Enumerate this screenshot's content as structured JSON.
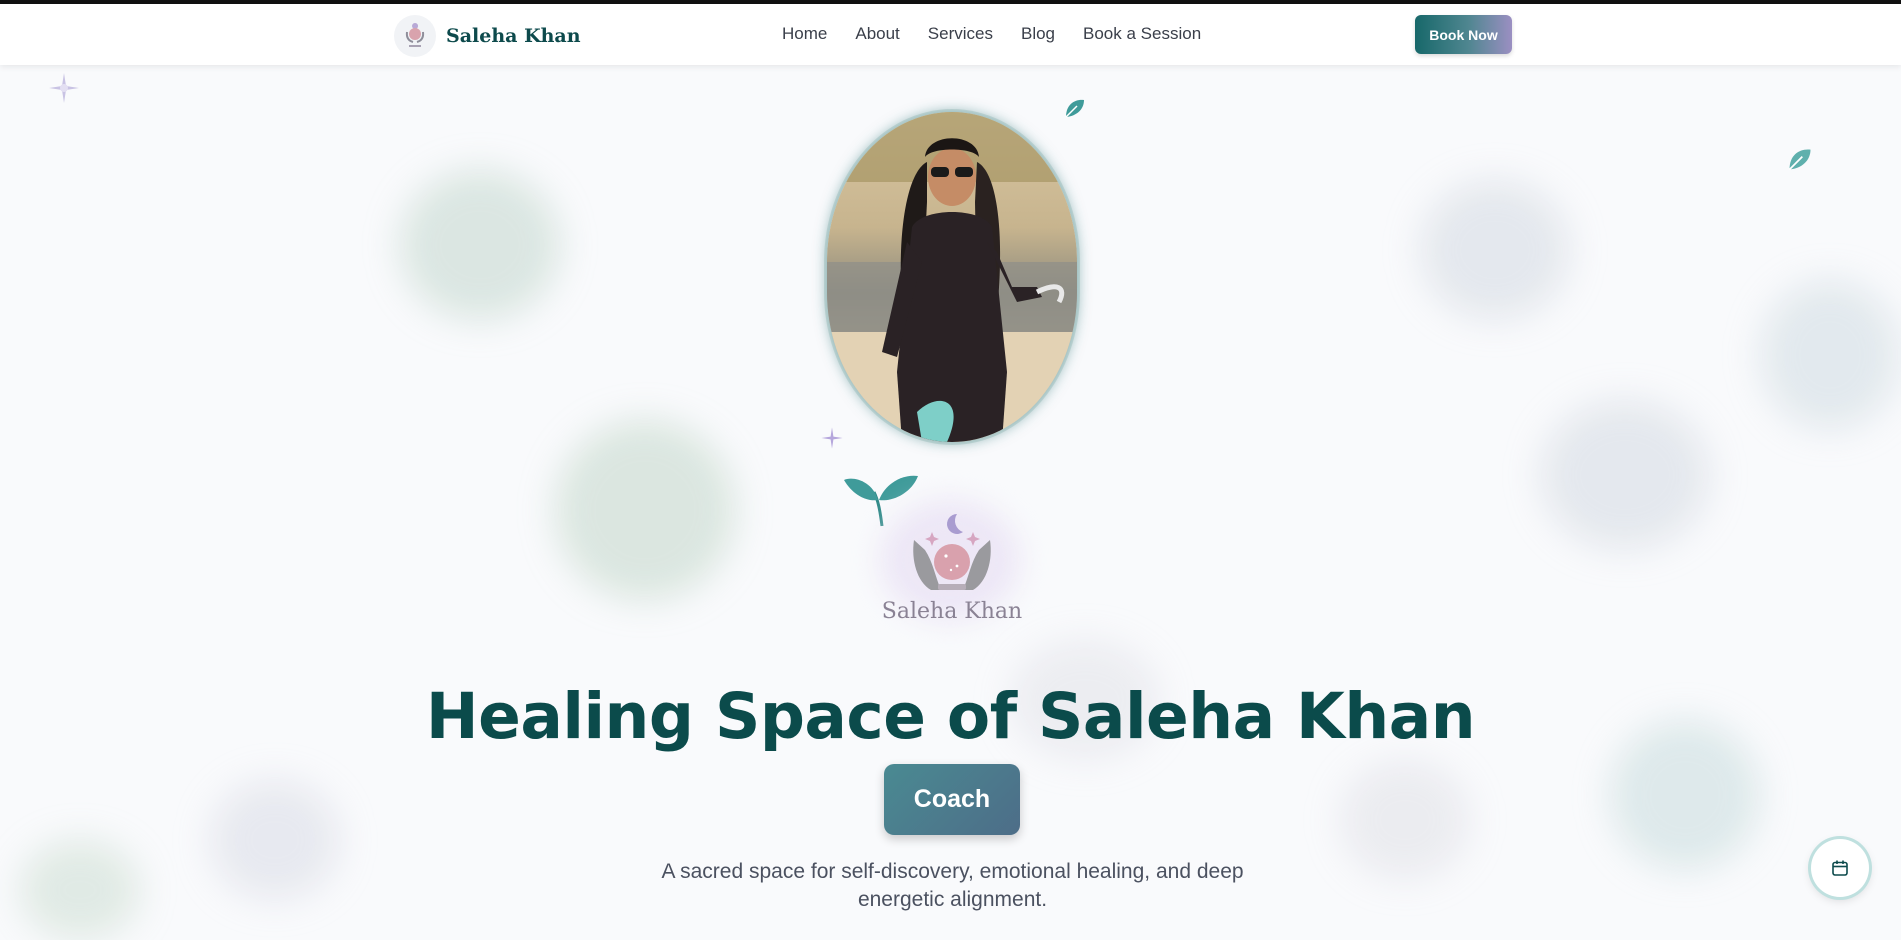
{
  "brand": {
    "name": "Saleha Khan"
  },
  "nav": {
    "links": [
      "Home",
      "About",
      "Services",
      "Blog",
      "Book a Session"
    ]
  },
  "actions": {
    "book_now": "Book Now"
  },
  "hero": {
    "emblem_name": "Saleha Khan",
    "title": "Healing Space of Saleha Khan",
    "role_button": "Coach",
    "tagline": "A sacred space for self-discovery, emotional healing, and deep energetic alignment."
  },
  "colors": {
    "primary": "#0b4b4b",
    "accent": "#4a8a92",
    "lavender": "#9b8fc2"
  },
  "icons": {
    "logo": "crystal-ball-hands-icon",
    "fab": "calendar-icon",
    "decor": [
      "sparkle-icon",
      "leaf-icon",
      "sprout-icon"
    ]
  }
}
